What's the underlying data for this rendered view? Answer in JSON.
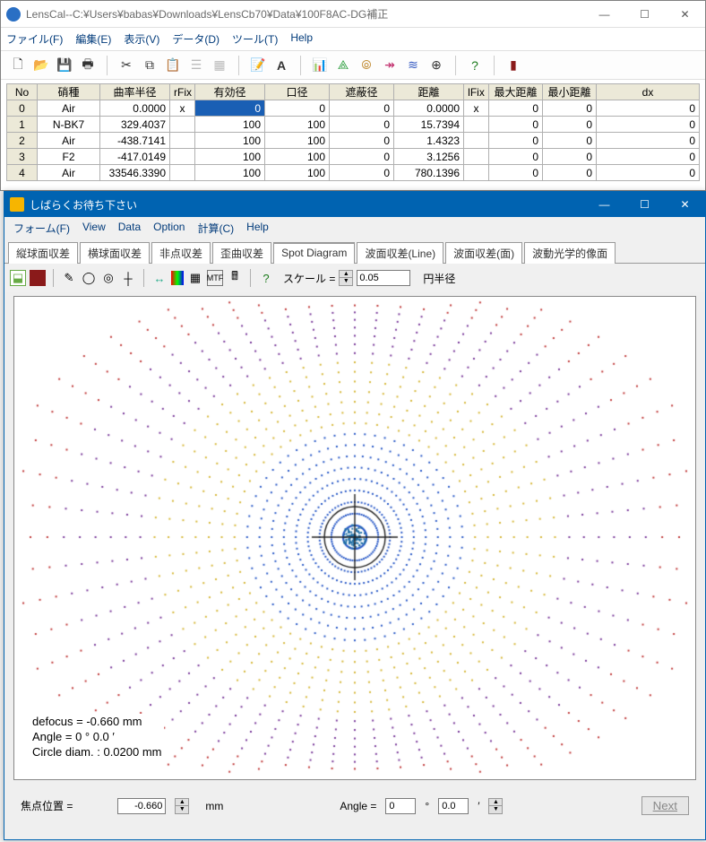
{
  "main_window": {
    "title": "LensCal--C:¥Users¥babas¥Downloads¥LensCb70¥Data¥100F8AC-DG補正",
    "menu": [
      "ファイル(F)",
      "編集(E)",
      "表示(V)",
      "データ(D)",
      "ツール(T)",
      "Help"
    ]
  },
  "table": {
    "headers": [
      "No",
      "硝種",
      "曲率半径",
      "rFix",
      "有効径",
      "口径",
      "遮蔽径",
      "距離",
      "lFix",
      "最大距離",
      "最小距離",
      "dx"
    ],
    "rows": [
      {
        "no": "0",
        "glass": "Air",
        "r": "0.0000",
        "rfix": "x",
        "ea": "0",
        "ap": "0",
        "obs": "0",
        "dist": "0.0000",
        "lfix": "x",
        "dmax": "0",
        "dmin": "0",
        "dx": "0",
        "sel": true
      },
      {
        "no": "1",
        "glass": "N-BK7",
        "r": "329.4037",
        "rfix": "",
        "ea": "100",
        "ap": "100",
        "obs": "0",
        "dist": "15.7394",
        "lfix": "",
        "dmax": "0",
        "dmin": "0",
        "dx": "0"
      },
      {
        "no": "2",
        "glass": "Air",
        "r": "-438.7141",
        "rfix": "",
        "ea": "100",
        "ap": "100",
        "obs": "0",
        "dist": "1.4323",
        "lfix": "",
        "dmax": "0",
        "dmin": "0",
        "dx": "0"
      },
      {
        "no": "3",
        "glass": "F2",
        "r": "-417.0149",
        "rfix": "",
        "ea": "100",
        "ap": "100",
        "obs": "0",
        "dist": "3.1256",
        "lfix": "",
        "dmax": "0",
        "dmin": "0",
        "dx": "0"
      },
      {
        "no": "4",
        "glass": "Air",
        "r": "33546.3390",
        "rfix": "",
        "ea": "100",
        "ap": "100",
        "obs": "0",
        "dist": "780.1396",
        "lfix": "",
        "dmax": "0",
        "dmin": "0",
        "dx": "0"
      }
    ]
  },
  "sub_window": {
    "title": "しばらくお待ち下さい",
    "menu": [
      "フォーム(F)",
      "View",
      "Data",
      "Option",
      "計算(C)",
      "Help"
    ],
    "tabs": [
      "縦球面収差",
      "横球面収差",
      "非点収差",
      "歪曲収差",
      "Spot Diagram",
      "波面収差(Line)",
      "波面収差(面)",
      "波動光学的像面"
    ],
    "active_tab": 4,
    "scale_label": "スケール =",
    "scale_value": "0.05",
    "scale_unit": "円半径",
    "plot_annotation": {
      "l1": "defocus = -0.660 mm",
      "l2": "Angle   = 0 °  0.0 ′",
      "l3": "Circle diam. : 0.0200 mm"
    },
    "controls": {
      "focus_label": "焦点位置 =",
      "focus_value": "-0.660",
      "focus_unit": "mm",
      "angle_label": "Angle =",
      "angle_deg": "0",
      "angle_min": "0.0",
      "next_label": "Next"
    }
  }
}
